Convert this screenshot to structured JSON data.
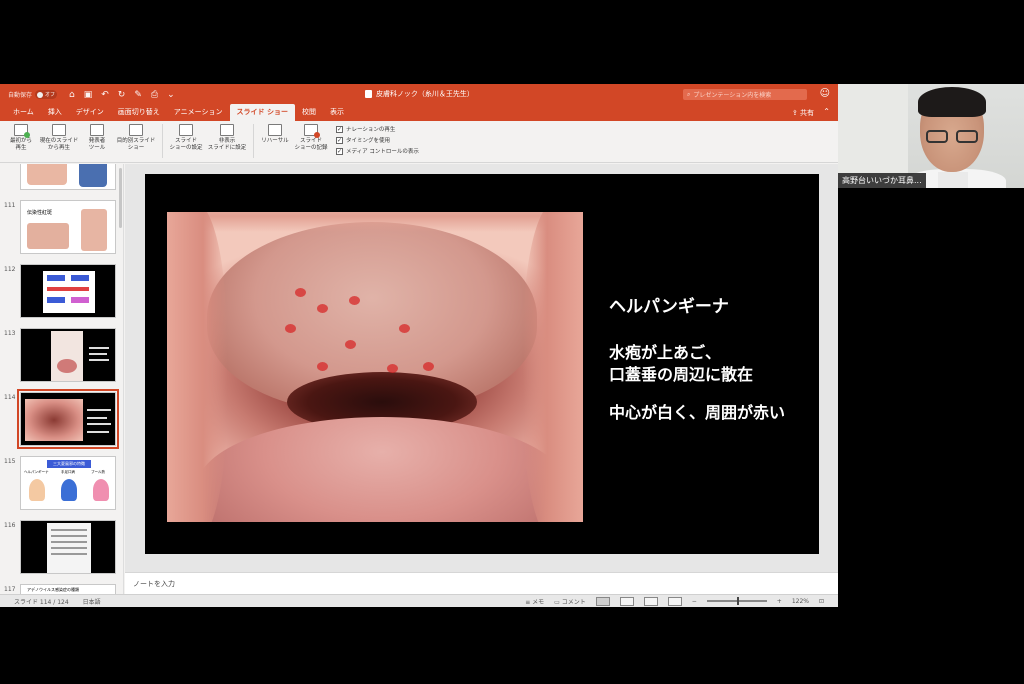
{
  "titlebar": {
    "autosave": "自動保存",
    "autosave_state": "オフ",
    "document_title": "皮膚科ノック（糸川＆王先生）",
    "search_placeholder": "プレゼンテーション内を検索"
  },
  "tabs": [
    {
      "label": "ホーム"
    },
    {
      "label": "挿入"
    },
    {
      "label": "デザイン"
    },
    {
      "label": "画面切り替え"
    },
    {
      "label": "アニメーション"
    },
    {
      "label": "スライド ショー",
      "active": true
    },
    {
      "label": "校閲"
    },
    {
      "label": "表示"
    }
  ],
  "share_label": "共有",
  "ribbon": {
    "from_start": "最初から\n再生",
    "from_current": "現在のスライド\nから再生",
    "presenter": "発表者\nツール",
    "custom": "目的別スライド\nショー",
    "setup": "スライド\nショーの設定",
    "hide": "非表示\nスライドに設定",
    "rehearse": "リハーサル",
    "record": "スライド\nショーの記録",
    "checks": [
      "ナレーションの再生",
      "タイミングを使用",
      "メディア コントロールの表示"
    ]
  },
  "thumbnails": {
    "n111": "111",
    "n112": "112",
    "n113": "113",
    "n114": "114",
    "n115": "115",
    "n116": "116",
    "n117": "117",
    "t111_title": "伝染性紅斑",
    "t115_title": "三大夏風邪の特徴",
    "t115_l1": "ヘルパンギーナ",
    "t115_l2": "手足口病",
    "t115_l3": "プール熱",
    "t117_title": "アデノウイルス感染症の種類"
  },
  "slide": {
    "heading": "ヘルパンギーナ",
    "line1": "水疱が上あご、",
    "line2": "口蓋垂の周辺に散在",
    "line3": "中心が白く、周囲が赤い"
  },
  "notes_placeholder": "ノートを入力",
  "status": {
    "slide_counter": "スライド 114 / 124",
    "language": "日本語",
    "notes": "メモ",
    "comments": "コメント",
    "zoom": "122%"
  },
  "webcam": {
    "participant_name": "高野台いいづか耳鼻..."
  }
}
